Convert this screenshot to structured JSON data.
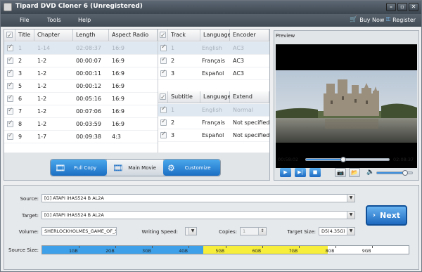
{
  "window": {
    "title": "Tipard DVD Cloner 6 (Unregistered)"
  },
  "menu": {
    "file": "File",
    "tools": "Tools",
    "help": "Help",
    "buy_now": "Buy Now",
    "register": "Register"
  },
  "titles_table": {
    "headers": [
      "Title",
      "Chapter",
      "Length",
      "Aspect Radio"
    ],
    "rows": [
      {
        "title": "1",
        "chapter": "1-14",
        "length": "02:08:37",
        "aspect": "16:9",
        "checked": true,
        "selected": true
      },
      {
        "title": "2",
        "chapter": "1-2",
        "length": "00:00:07",
        "aspect": "16:9",
        "checked": true
      },
      {
        "title": "3",
        "chapter": "1-2",
        "length": "00:00:11",
        "aspect": "16:9",
        "checked": true
      },
      {
        "title": "5",
        "chapter": "1-2",
        "length": "00:00:12",
        "aspect": "16:9",
        "checked": true
      },
      {
        "title": "6",
        "chapter": "1-2",
        "length": "00:05:16",
        "aspect": "16:9",
        "checked": true
      },
      {
        "title": "7",
        "chapter": "1-2",
        "length": "00:07:06",
        "aspect": "16:9",
        "checked": true
      },
      {
        "title": "8",
        "chapter": "1-2",
        "length": "00:03:59",
        "aspect": "16:9",
        "checked": true
      },
      {
        "title": "9",
        "chapter": "1-7",
        "length": "00:09:38",
        "aspect": "4:3",
        "checked": true
      }
    ]
  },
  "audio_table": {
    "headers": [
      "Track",
      "Language",
      "Encoder"
    ],
    "rows": [
      {
        "track": "1",
        "language": "English",
        "encoder": "AC3",
        "selected": true
      },
      {
        "track": "2",
        "language": "Français",
        "encoder": "AC3"
      },
      {
        "track": "3",
        "language": "Español",
        "encoder": "AC3"
      }
    ]
  },
  "subtitle_table": {
    "headers": [
      "Subtitle",
      "Language",
      "Extend"
    ],
    "rows": [
      {
        "subtitle": "1",
        "language": "English",
        "extend": "Normal",
        "selected": true
      },
      {
        "subtitle": "2",
        "language": "Français",
        "extend": "Not specified"
      },
      {
        "subtitle": "3",
        "language": "Español",
        "extend": "Not specified"
      }
    ]
  },
  "modes": {
    "full_copy": "Full Copy",
    "main_movie": "Main Movie",
    "customize": "Customize"
  },
  "preview": {
    "label": "Preview",
    "time_current": "00:58:02",
    "time_total": "02:08:37",
    "seek_fraction": 0.45,
    "volume_fraction": 0.8
  },
  "settings": {
    "source_label": "Source:",
    "source_value": "[G] ATAPI iHAS524   B AL2A",
    "target_label": "Target:",
    "target_value": "[G] ATAPI iHAS524   B AL2A",
    "volume_label": "Volume:",
    "volume_value": "SHERLOCKHOLMES_GAME_OF_SH",
    "writing_speed_label": "Writing Speed:",
    "writing_speed_value": "",
    "copies_label": "Copies:",
    "copies_value": "1",
    "target_size_label": "Target Size:",
    "target_size_value": "D5(4.35G)",
    "next_label": "Next",
    "source_size_label": "Source Size:",
    "size_ticks": [
      "1GB",
      "2GB",
      "3GB",
      "4GB",
      "5GB",
      "6GB",
      "7GB",
      "8GB",
      "9GB"
    ],
    "used_fraction_blue": 0.44,
    "used_fraction_yellow": 0.78
  },
  "colors": {
    "accent": "#1d6fc4",
    "blue_fill": "#3ea0e8",
    "yellow_fill": "#f6ee3a"
  }
}
